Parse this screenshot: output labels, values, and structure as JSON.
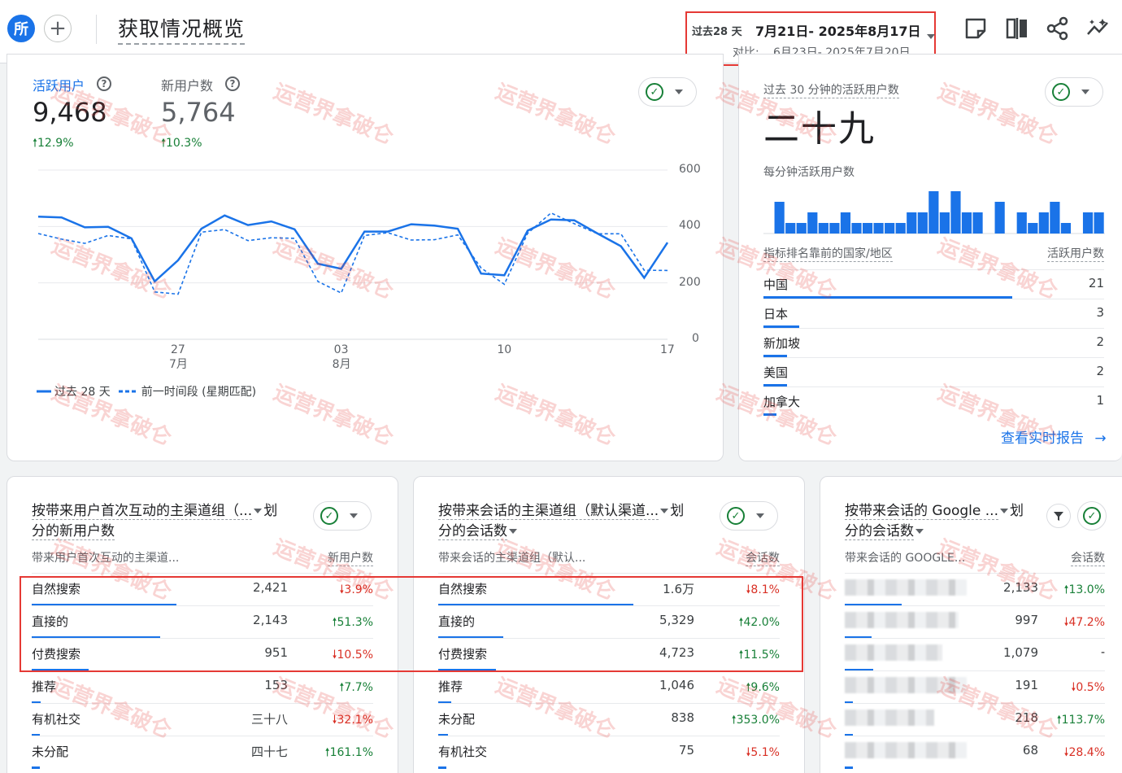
{
  "header": {
    "avatar_text": "所",
    "add_symbol": "+",
    "title": "获取情况概览",
    "date_label": "过去28 天",
    "date_range": "7月21日- 2025年8月17日",
    "compare_label": "对比:",
    "compare_range": "6月23日- 2025年7月20日",
    "icons": [
      "note-icon",
      "compare-icon",
      "share-icon",
      "insights-icon"
    ]
  },
  "watermark_text": "运营界拿破仑",
  "users_card": {
    "active_users_label": "活跃用户",
    "active_users_value": "9,468",
    "active_users_change": "12.9%",
    "new_users_label": "新用户数",
    "new_users_value": "5,764",
    "new_users_change": "10.3%",
    "legend_current": "过去 28 天",
    "legend_previous": "前一时间段 (星期匹配)"
  },
  "chart_data": {
    "type": "line",
    "title": "",
    "xlabel": "",
    "ylabel": "",
    "x": [
      "7月21日",
      "7月22日",
      "7月23日",
      "7月24日",
      "7月25日",
      "7月26日",
      "7月27日",
      "7月28日",
      "7月29日",
      "7月30日",
      "7月31日",
      "8月1日",
      "8月2日",
      "8月3日",
      "8月4日",
      "8月5日",
      "8月6日",
      "8月7日",
      "8月8日",
      "8月9日",
      "8月10日",
      "8月11日",
      "8月12日",
      "8月13日",
      "8月14日",
      "8月15日",
      "8月16日",
      "8月17日"
    ],
    "x_tick_labels": [
      {
        "day": "27",
        "month": "7月",
        "index": 6
      },
      {
        "day": "03",
        "month": "8月",
        "index": 13
      },
      {
        "day": "10",
        "month": "",
        "index": 20
      },
      {
        "day": "17",
        "month": "",
        "index": 27
      }
    ],
    "y_ticks": [
      "600",
      "400",
      "200",
      "0"
    ],
    "ylim": [
      0,
      600
    ],
    "series": [
      {
        "name": "过去 28 天",
        "style": "solid",
        "color": "#1a73e8",
        "values": [
          435,
          432,
          397,
          399,
          358,
          205,
          280,
          392,
          439,
          405,
          418,
          390,
          268,
          250,
          382,
          382,
          408,
          403,
          392,
          233,
          227,
          385,
          425,
          422,
          375,
          330,
          218,
          343
        ]
      },
      {
        "name": "前一时间段 (星期匹配)",
        "style": "dashed",
        "color": "#1a73e8",
        "values": [
          375,
          355,
          340,
          368,
          356,
          168,
          160,
          380,
          389,
          350,
          360,
          358,
          205,
          164,
          368,
          378,
          352,
          353,
          370,
          253,
          195,
          376,
          448,
          410,
          374,
          374,
          245,
          244
        ]
      }
    ],
    "grid": true
  },
  "realtime_card": {
    "title": "过去 30 分钟的活跃用户数",
    "value": "二十九",
    "subtitle": "每分钟活跃用户数",
    "minute_bars": [
      0,
      3,
      1,
      1,
      2,
      1,
      1,
      2,
      1,
      1,
      1,
      1,
      1,
      2,
      2,
      4,
      2,
      4,
      2,
      2,
      0,
      3,
      0,
      2,
      1,
      2,
      3,
      1,
      0,
      2,
      2
    ],
    "table_head_left": "指标排名靠前的国家/地区",
    "table_head_right": "活跃用户数",
    "rows": [
      {
        "name": "中国",
        "value": "21",
        "share": 1.0
      },
      {
        "name": "日本",
        "value": "3",
        "share": 0.143
      },
      {
        "name": "新加坡",
        "value": "2",
        "share": 0.095
      },
      {
        "name": "美国",
        "value": "2",
        "share": 0.095
      },
      {
        "name": "加拿大",
        "value": "1",
        "share": 0.048
      }
    ],
    "link_text": "查看实时报告"
  },
  "card_a": {
    "title_line1": "按带来用户首次互动的主渠道组（...",
    "title_line1_suffix": "划",
    "title_line2": "分的新用户数",
    "col_left": "带来用户首次互动的主渠道...",
    "col_right": "新用户数",
    "rows": [
      {
        "name": "自然搜索",
        "value": "2,421",
        "change": "3.9%",
        "dir": "down",
        "share": 1.0
      },
      {
        "name": "直接的",
        "value": "2,143",
        "change": "51.3%",
        "dir": "up",
        "share": 0.885
      },
      {
        "name": "付费搜索",
        "value": "951",
        "change": "10.5%",
        "dir": "down",
        "share": 0.393
      },
      {
        "name": "推荐",
        "value": "153",
        "change": "7.7%",
        "dir": "up",
        "share": 0.063
      },
      {
        "name": "有机社交",
        "value": "三十八",
        "change": "32.1%",
        "dir": "down",
        "share": 0.016
      },
      {
        "name": "未分配",
        "value": "四十七",
        "change": "161.1%",
        "dir": "up",
        "share": 0.019
      }
    ]
  },
  "card_b": {
    "title_line1": "按带来会话的主渠道组（默认渠道...",
    "title_line1_suffix": "划",
    "title_line2": "分的会话数",
    "col_left": "带来会话的主渠道组（默认...",
    "col_right": "会话数",
    "rows": [
      {
        "name": "自然搜索",
        "value": "1.6万",
        "change": "8.1%",
        "dir": "down",
        "share": 1.0
      },
      {
        "name": "直接的",
        "value": "5,329",
        "change": "42.0%",
        "dir": "up",
        "share": 0.333
      },
      {
        "name": "付费搜索",
        "value": "4,723",
        "change": "11.5%",
        "dir": "up",
        "share": 0.295
      },
      {
        "name": "推荐",
        "value": "1,046",
        "change": "9.6%",
        "dir": "up",
        "share": 0.065
      },
      {
        "name": "未分配",
        "value": "838",
        "change": "353.0%",
        "dir": "up",
        "share": 0.052
      },
      {
        "name": "有机社交",
        "value": "75",
        "change": "5.1%",
        "dir": "down",
        "share": 0.005
      }
    ]
  },
  "card_c": {
    "title_line1": "按带来会话的 Google ...",
    "title_line1_suffix": "划",
    "title_line2": "分的会话数",
    "col_left": "带来会话的 GOOGLE...",
    "col_right": "会话数",
    "rows": [
      {
        "value": "2,133",
        "change": "13.0%",
        "dir": "up",
        "share": 1.0
      },
      {
        "value": "997",
        "change": "47.2%",
        "dir": "down",
        "share": 0.467
      },
      {
        "value": "1,079",
        "change": "-",
        "dir": "none",
        "share": 0.506
      },
      {
        "value": "191",
        "change": "0.5%",
        "dir": "down",
        "share": 0.09
      },
      {
        "value": "218",
        "change": "113.7%",
        "dir": "up",
        "share": 0.102
      },
      {
        "value": "68",
        "change": "28.4%",
        "dir": "down",
        "share": 0.032
      }
    ]
  },
  "colors": {
    "accent": "#1a73e8",
    "positive": "#188038",
    "negative": "#d93025",
    "highlight_box": "#e53935"
  }
}
